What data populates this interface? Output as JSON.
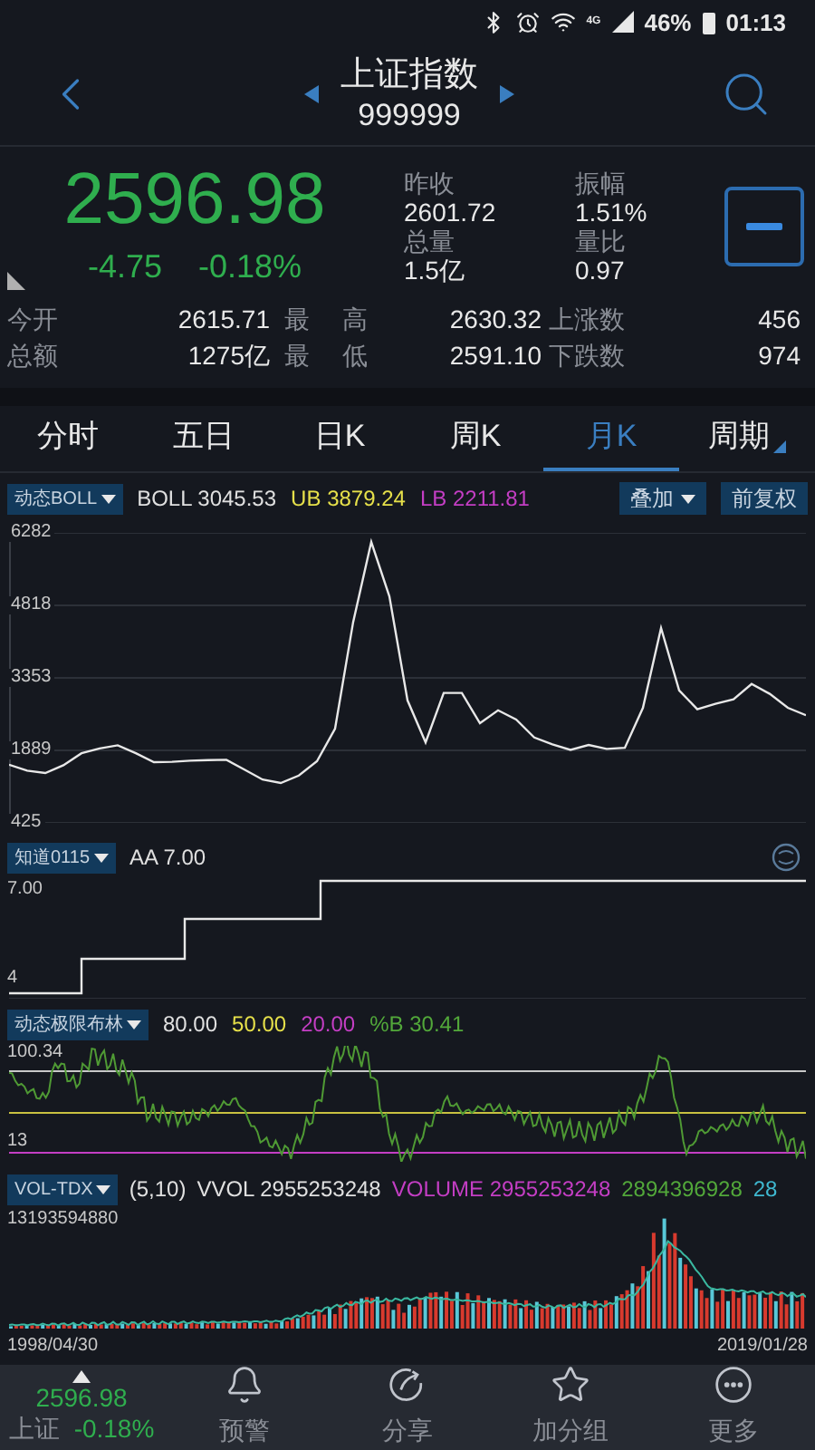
{
  "status_bar": {
    "network": "4G",
    "battery": "46%",
    "time": "01:13"
  },
  "header": {
    "title": "上证指数",
    "code": "999999"
  },
  "quote": {
    "price": "2596.98",
    "change": "-4.75",
    "change_pct": "-0.18%",
    "stats": [
      {
        "label": "昨收",
        "value": "2601.72"
      },
      {
        "label": "振幅",
        "value": "1.51%"
      },
      {
        "label": "总量",
        "value": "1.5亿"
      },
      {
        "label": "量比",
        "value": "0.97"
      }
    ]
  },
  "details": [
    {
      "label": "今开",
      "value": "2615.71",
      "label2": "最 高",
      "value2": "2630.32",
      "label3": "上涨数",
      "value3": "456"
    },
    {
      "label": "总额",
      "value": "1275亿",
      "label2": "最 低",
      "value2": "2591.10",
      "label3": "下跌数",
      "value3": "974"
    }
  ],
  "tabs": [
    {
      "label": "分时",
      "selected": false,
      "kind": "plain"
    },
    {
      "label": "五日",
      "selected": false,
      "kind": "plain"
    },
    {
      "label": "日K",
      "selected": false,
      "kind": "plain"
    },
    {
      "label": "周K",
      "selected": false,
      "kind": "plain"
    },
    {
      "label": "月K",
      "selected": true,
      "kind": "plain"
    },
    {
      "label": "周期",
      "selected": false,
      "kind": "menu"
    }
  ],
  "panels": [
    {
      "kind": "price",
      "selector": "动态BOLL",
      "readings": [
        {
          "label": "BOLL",
          "value": "3045.53",
          "color": "#e0e0e0"
        },
        {
          "label": "UB",
          "value": "3879.24",
          "color": "#e6e04a"
        },
        {
          "label": "LB",
          "value": "2211.81",
          "color": "#c43ec4"
        }
      ],
      "buttons": [
        {
          "label": "叠加",
          "kind": "menu"
        },
        {
          "label": "前复权",
          "kind": "plain"
        }
      ],
      "chart_data": {
        "type": "line",
        "grid": true,
        "ylim": [
          425,
          6282
        ],
        "yticks": [
          6282,
          4818,
          3353,
          1889,
          425
        ],
        "series": [
          {
            "color": "#e8e8e8",
            "values": [
              1600,
              1480,
              1430,
              1590,
              1830,
              1930,
              1990,
              1830,
              1650,
              1660,
              1680,
              1690,
              1700,
              1500,
              1300,
              1230,
              1380,
              1670,
              2330,
              4480,
              6100,
              5000,
              2900,
              2050,
              3050,
              3050,
              2440,
              2700,
              2510,
              2150,
              2010,
              1900,
              2000,
              1920,
              1940,
              2750,
              4360,
              3100,
              2720,
              2830,
              2920,
              3230,
              3030,
              2750,
              2600
            ]
          }
        ]
      }
    },
    {
      "kind": "steps",
      "selector": "知道0115",
      "readings": [
        {
          "label": "AA",
          "value": "7.00",
          "color": "#e0e0e0"
        }
      ],
      "y_labels": [
        "7.00",
        "4"
      ]
    },
    {
      "kind": "percent_b",
      "selector": "动态极限布林",
      "readings": [
        {
          "value": "80.00",
          "color": "#e0e0e0"
        },
        {
          "value": "50.00",
          "color": "#e6e04a"
        },
        {
          "value": "20.00",
          "color": "#c43ec4"
        },
        {
          "label": "%B",
          "value": "30.41",
          "color": "#52a83a"
        }
      ],
      "y_labels": [
        "100.34",
        "13"
      ]
    },
    {
      "kind": "volume",
      "selector": "VOL-TDX",
      "readings": [
        {
          "value": "(5,10)",
          "color": "#e0e0e0"
        },
        {
          "label": "VVOL",
          "value": "2955253248",
          "color": "#e0e0e0"
        },
        {
          "label": "VOLUME",
          "value": "2955253248",
          "color": "#c43ec4"
        },
        {
          "value": "2894396928",
          "color": "#52a83a"
        },
        {
          "value": "28",
          "color": "#3fb8d0"
        }
      ],
      "y_labels": [
        "13193594880"
      ],
      "start_date": "1998/04/30",
      "end_date": "2019/01/28"
    }
  ],
  "bottom_bar": {
    "price": "2596.98",
    "name": "上证",
    "change_pct": "-0.18%",
    "items": [
      {
        "label": "预警",
        "kind": "alert"
      },
      {
        "label": "分享",
        "kind": "share"
      },
      {
        "label": "加分组",
        "kind": "group"
      },
      {
        "label": "更多",
        "kind": "more"
      }
    ]
  }
}
